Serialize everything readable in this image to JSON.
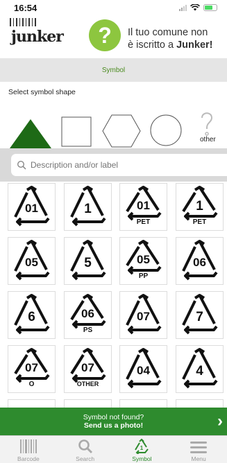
{
  "status_bar": {
    "time": "16:54"
  },
  "header": {
    "logo_text": "junker",
    "promo_line1": "Il tuo comune non",
    "promo_line2_prefix": "è iscritto a ",
    "promo_line2_brand": "Junker!",
    "badge_symbol": "?"
  },
  "tabstrip": {
    "active_label": "Symbol"
  },
  "shape_selector": {
    "title": "Select symbol shape",
    "shapes": [
      "triangle",
      "square",
      "hexagon",
      "circle",
      "other"
    ],
    "selected": "triangle",
    "other_label": "other",
    "accent_color": "#1e6a16"
  },
  "search": {
    "placeholder": "Description and/or label",
    "value": ""
  },
  "symbols": {
    "row1": [
      {
        "num": "01",
        "sub": ""
      },
      {
        "num": "1",
        "sub": ""
      },
      {
        "num": "01",
        "sub": "PET"
      },
      {
        "num": "1",
        "sub": "PET"
      }
    ],
    "row2": [
      {
        "num": "05",
        "sub": ""
      },
      {
        "num": "5",
        "sub": ""
      },
      {
        "num": "05",
        "sub": "PP"
      },
      {
        "num": "06",
        "sub": ""
      }
    ],
    "row3": [
      {
        "num": "6",
        "sub": ""
      },
      {
        "num": "06",
        "sub": "PS"
      },
      {
        "num": "07",
        "sub": ""
      },
      {
        "num": "7",
        "sub": ""
      }
    ],
    "row4": [
      {
        "num": "07",
        "sub": "O"
      },
      {
        "num": "07",
        "sub": "OTHER"
      },
      {
        "num": "04",
        "sub": ""
      },
      {
        "num": "4",
        "sub": ""
      }
    ]
  },
  "banner": {
    "line1": "Symbol not found?",
    "line2": "Send us a photo!",
    "arrow": "›"
  },
  "tabbar": {
    "items": [
      {
        "label": "Barcode",
        "icon": "barcode-icon"
      },
      {
        "label": "Search",
        "icon": "search-icon"
      },
      {
        "label": "Symbol",
        "icon": "recycle-icon"
      },
      {
        "label": "Menu",
        "icon": "menu-icon"
      }
    ],
    "active": "Symbol",
    "active_color": "#2e8b2e"
  }
}
